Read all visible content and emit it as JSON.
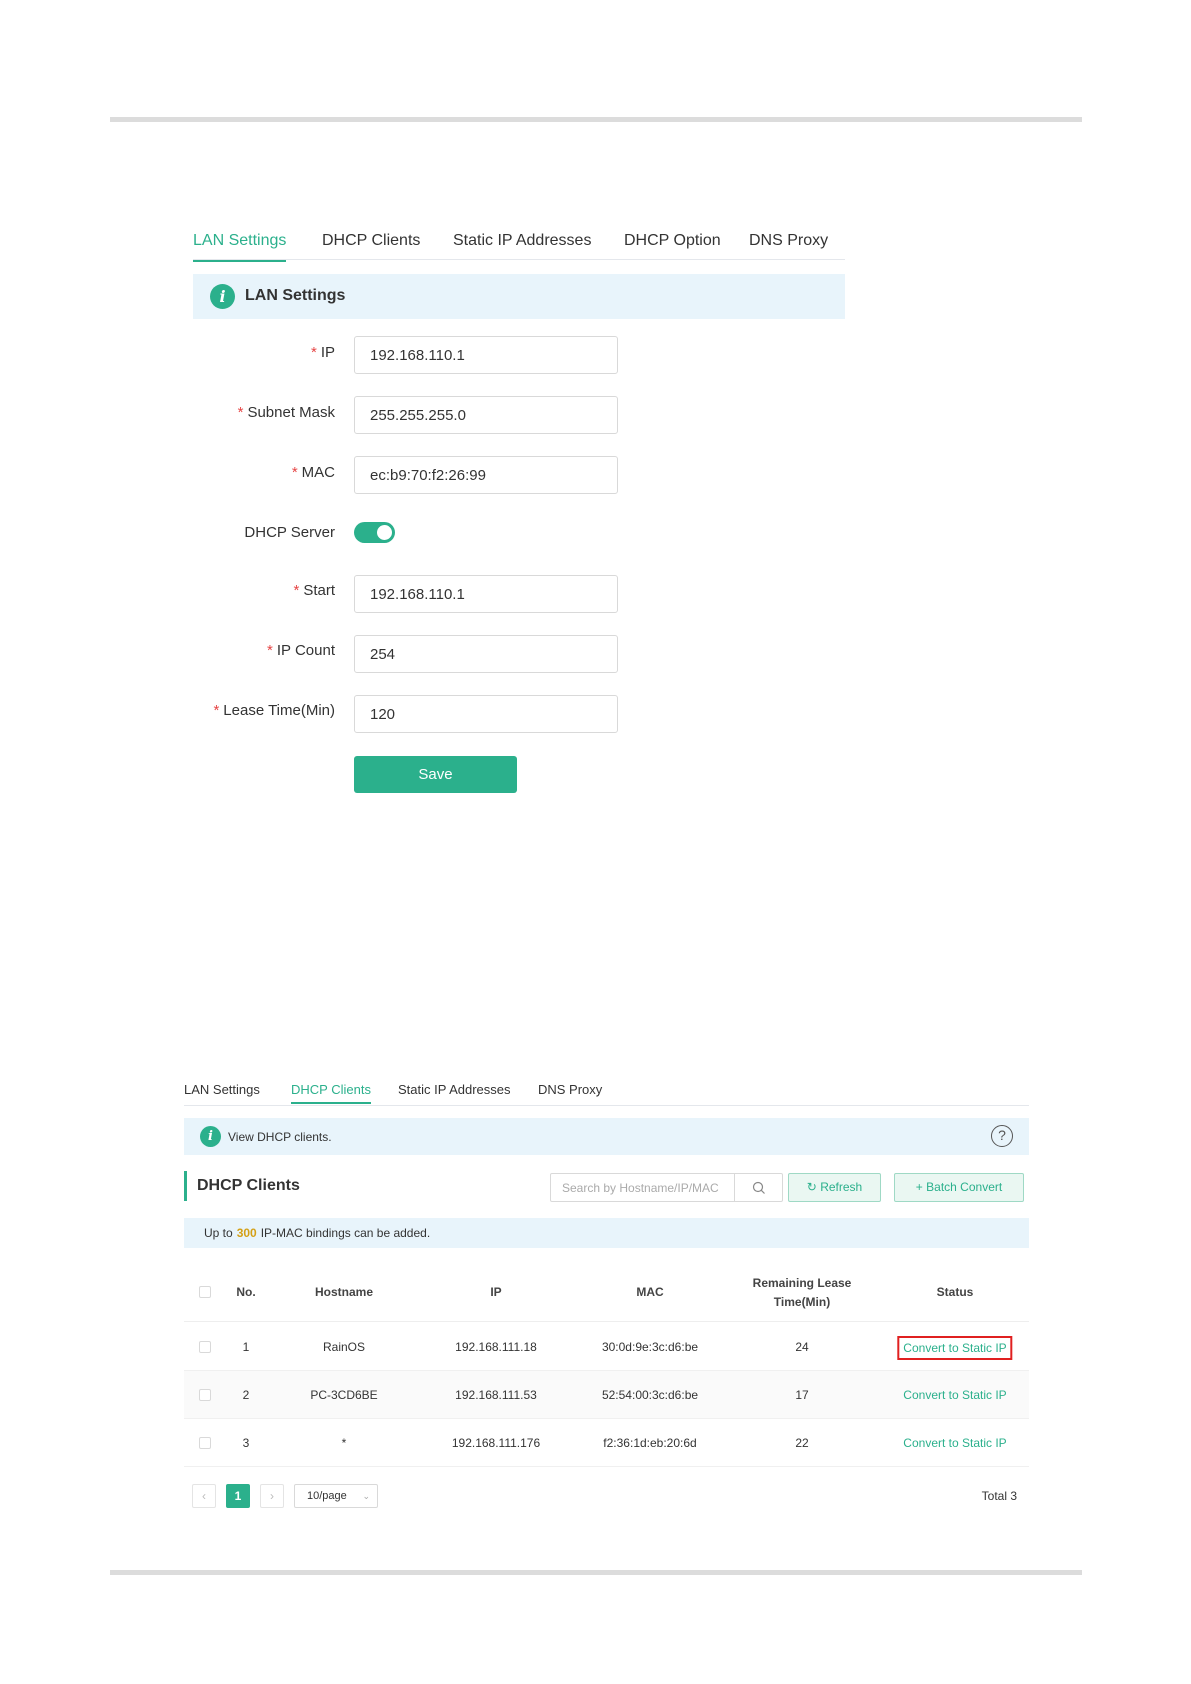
{
  "lan_screen": {
    "tabs": [
      {
        "label": "LAN Settings",
        "active": true
      },
      {
        "label": "DHCP Clients",
        "active": false
      },
      {
        "label": "Static IP Addresses",
        "active": false
      },
      {
        "label": "DHCP Option",
        "active": false
      },
      {
        "label": "DNS Proxy",
        "active": false
      }
    ],
    "banner_title": "LAN Settings",
    "required_mark": "*",
    "fields": {
      "ip": {
        "label": "IP",
        "value": "192.168.110.1"
      },
      "subnet": {
        "label": "Subnet Mask",
        "value": "255.255.255.0"
      },
      "mac": {
        "label": "MAC",
        "value": "ec:b9:70:f2:26:99"
      },
      "dhcp_server": {
        "label": "DHCP Server",
        "on": true
      },
      "start": {
        "label": "Start",
        "value": "192.168.110.1"
      },
      "ip_count": {
        "label": "IP Count",
        "value": "254"
      },
      "lease": {
        "label": "Lease Time(Min)",
        "value": "120"
      }
    },
    "save_label": "Save"
  },
  "dhcp_screen": {
    "tabs": [
      {
        "label": "LAN Settings",
        "active": false
      },
      {
        "label": "DHCP Clients",
        "active": true
      },
      {
        "label": "Static IP Addresses",
        "active": false
      },
      {
        "label": "DNS Proxy",
        "active": false
      }
    ],
    "banner_text": "View DHCP clients.",
    "help_glyph": "?",
    "section_title": "DHCP Clients",
    "search_placeholder": "Search by Hostname/IP/MAC",
    "refresh_label": "Refresh",
    "batch_label": "Batch Convert",
    "notice": {
      "prefix": "Up to",
      "count": "300",
      "suffix": "IP-MAC bindings can be added."
    },
    "columns": {
      "no": "No.",
      "hostname": "Hostname",
      "ip": "IP",
      "mac": "MAC",
      "lease_1": "Remaining Lease",
      "lease_2": "Time(Min)",
      "status": "Status"
    },
    "rows": [
      {
        "no": "1",
        "hostname": "RainOS",
        "ip": "192.168.111.18",
        "mac": "30:0d:9e:3c:d6:be",
        "lease": "24",
        "action": "Convert to Static IP"
      },
      {
        "no": "2",
        "hostname": "PC-3CD6BE",
        "ip": "192.168.111.53",
        "mac": "52:54:00:3c:d6:be",
        "lease": "17",
        "action": "Convert to Static IP"
      },
      {
        "no": "3",
        "hostname": "*",
        "ip": "192.168.111.176",
        "mac": "f2:36:1d:eb:20:6d",
        "lease": "22",
        "action": "Convert to Static IP"
      }
    ],
    "pager": {
      "prev": "‹",
      "current": "1",
      "next": "›",
      "page_size": "10/page",
      "page_size_chevron": "⌄",
      "total": "Total 3"
    }
  },
  "colors": {
    "accent": "#2bb08c",
    "highlight_box": "#e02020",
    "banner_bg": "#e8f4fb",
    "notice_number": "#d4a017"
  },
  "icons": {
    "info": "info-icon",
    "help": "help-circle-icon",
    "search": "search-icon",
    "refresh": "refresh-icon",
    "plus": "plus-icon",
    "info_glyph": "i",
    "refresh_glyph": "↻",
    "plus_glyph": "+"
  }
}
